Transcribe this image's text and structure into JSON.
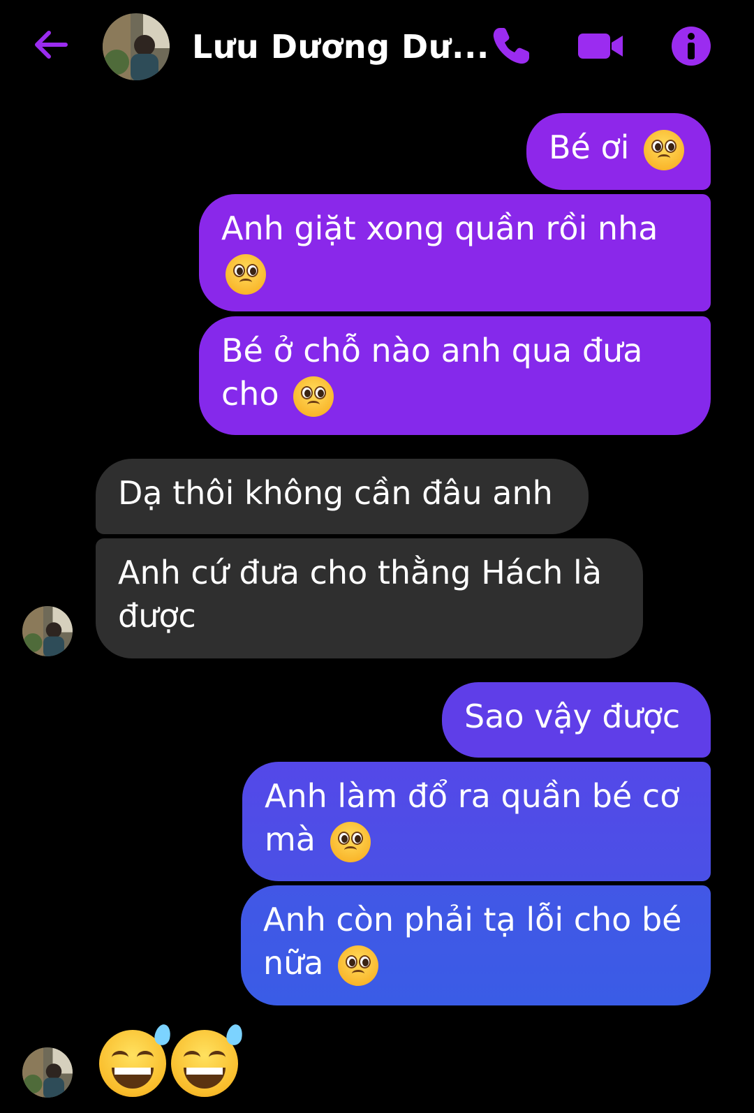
{
  "header": {
    "contact_name": "Lưu Dương Dư...",
    "back_icon": "arrow-left-icon",
    "call_icon": "phone-icon",
    "video_icon": "video-camera-icon",
    "info_icon": "info-icon",
    "accent_color": "#9b2cf0"
  },
  "theme": {
    "my_bubble_top": "#8e26e9",
    "my_bubble_bottom": "#3a5ce6",
    "their_bubble": "#2f2f2f",
    "background": "#000000"
  },
  "messages": [
    {
      "sender": "me",
      "text": "Bé ơi",
      "emoji": "pleading-face"
    },
    {
      "sender": "me",
      "text": "Anh giặt xong quần rồi nha",
      "emoji": "pleading-face"
    },
    {
      "sender": "me",
      "text": "Bé ở chỗ nào anh qua đưa cho",
      "emoji": "pleading-face"
    },
    {
      "sender": "them",
      "text": "Dạ thôi không cần đâu anh"
    },
    {
      "sender": "them",
      "text": "Anh cứ đưa cho thằng Hách là được"
    },
    {
      "sender": "me",
      "text": "Sao vậy được"
    },
    {
      "sender": "me",
      "text": "Anh làm đổ ra quần bé cơ mà",
      "emoji": "pleading-face"
    },
    {
      "sender": "me",
      "text": "Anh còn phải tạ lỗi cho bé nữa",
      "emoji": "pleading-face"
    },
    {
      "sender": "them",
      "emoji": "grinning-face-with-sweat",
      "count": 2
    }
  ]
}
